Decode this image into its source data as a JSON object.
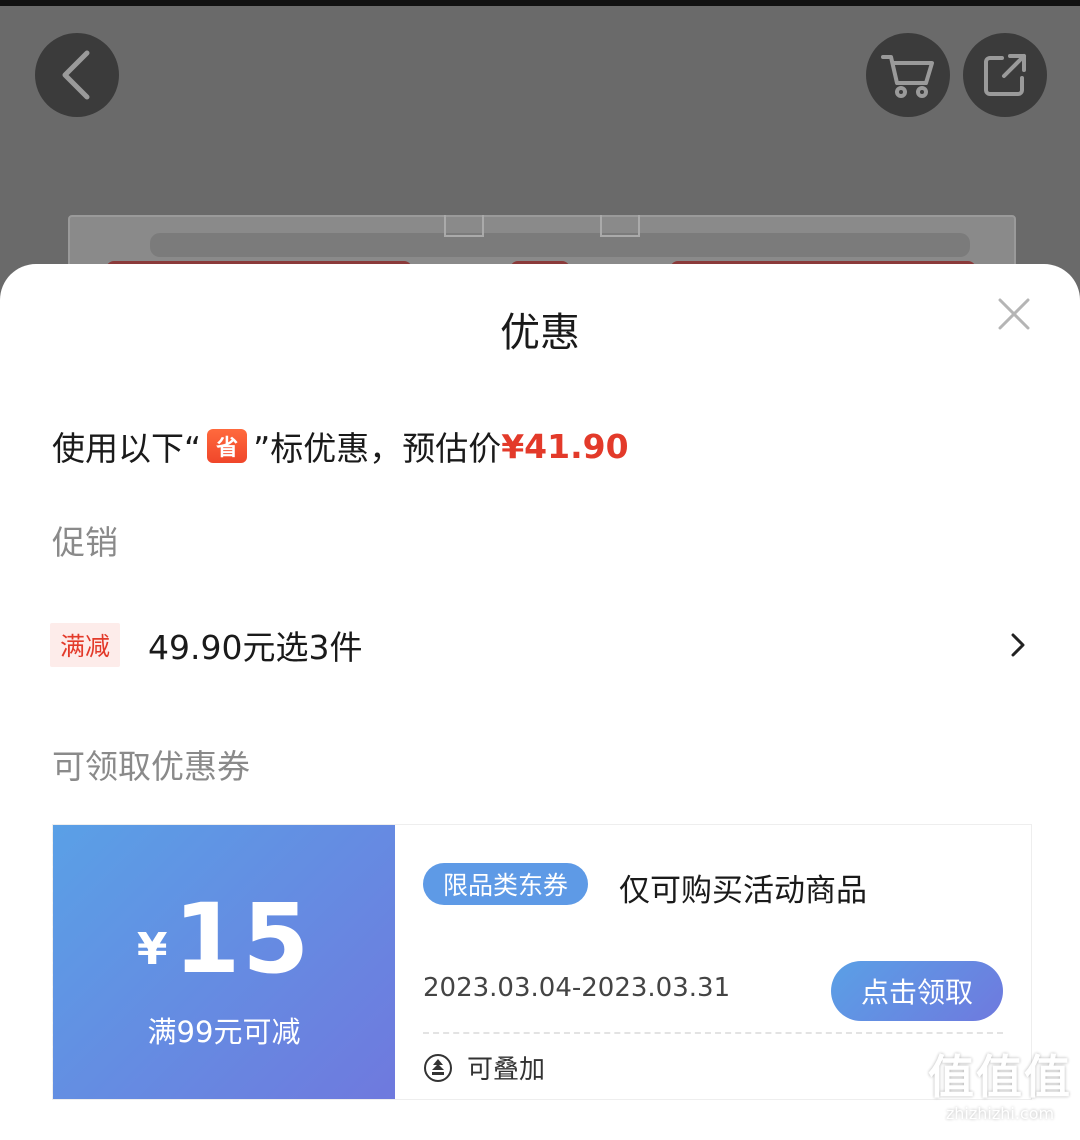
{
  "sheet": {
    "title": "优惠",
    "estimate": {
      "prefix": "使用以下“",
      "badge": "省",
      "suffix": "”标优惠，预估价",
      "price": "¥41.90"
    },
    "promotion_section": "促销",
    "promotion": {
      "tag": "满减",
      "text": "49.90元选3件"
    },
    "coupon_section": "可领取优惠券",
    "coupon": {
      "currency": "¥",
      "amount": "15",
      "condition": "满99元可减",
      "type": "限品类东券",
      "description": "仅可购买活动商品",
      "date_range": "2023.03.04-2023.03.31",
      "claim_label": "点击领取",
      "stack_label": "可叠加"
    }
  },
  "watermark": {
    "logo": "值值值",
    "site": "zhizhizhi.com"
  },
  "icons": [
    "back-icon",
    "cart-icon",
    "share-icon",
    "close-icon",
    "chevron-right-icon",
    "stack-icon"
  ],
  "colors": {
    "accent_red": "#e33a2a",
    "coupon_blue": "#5e9ae6",
    "coupon_purple": "#6f79de"
  }
}
